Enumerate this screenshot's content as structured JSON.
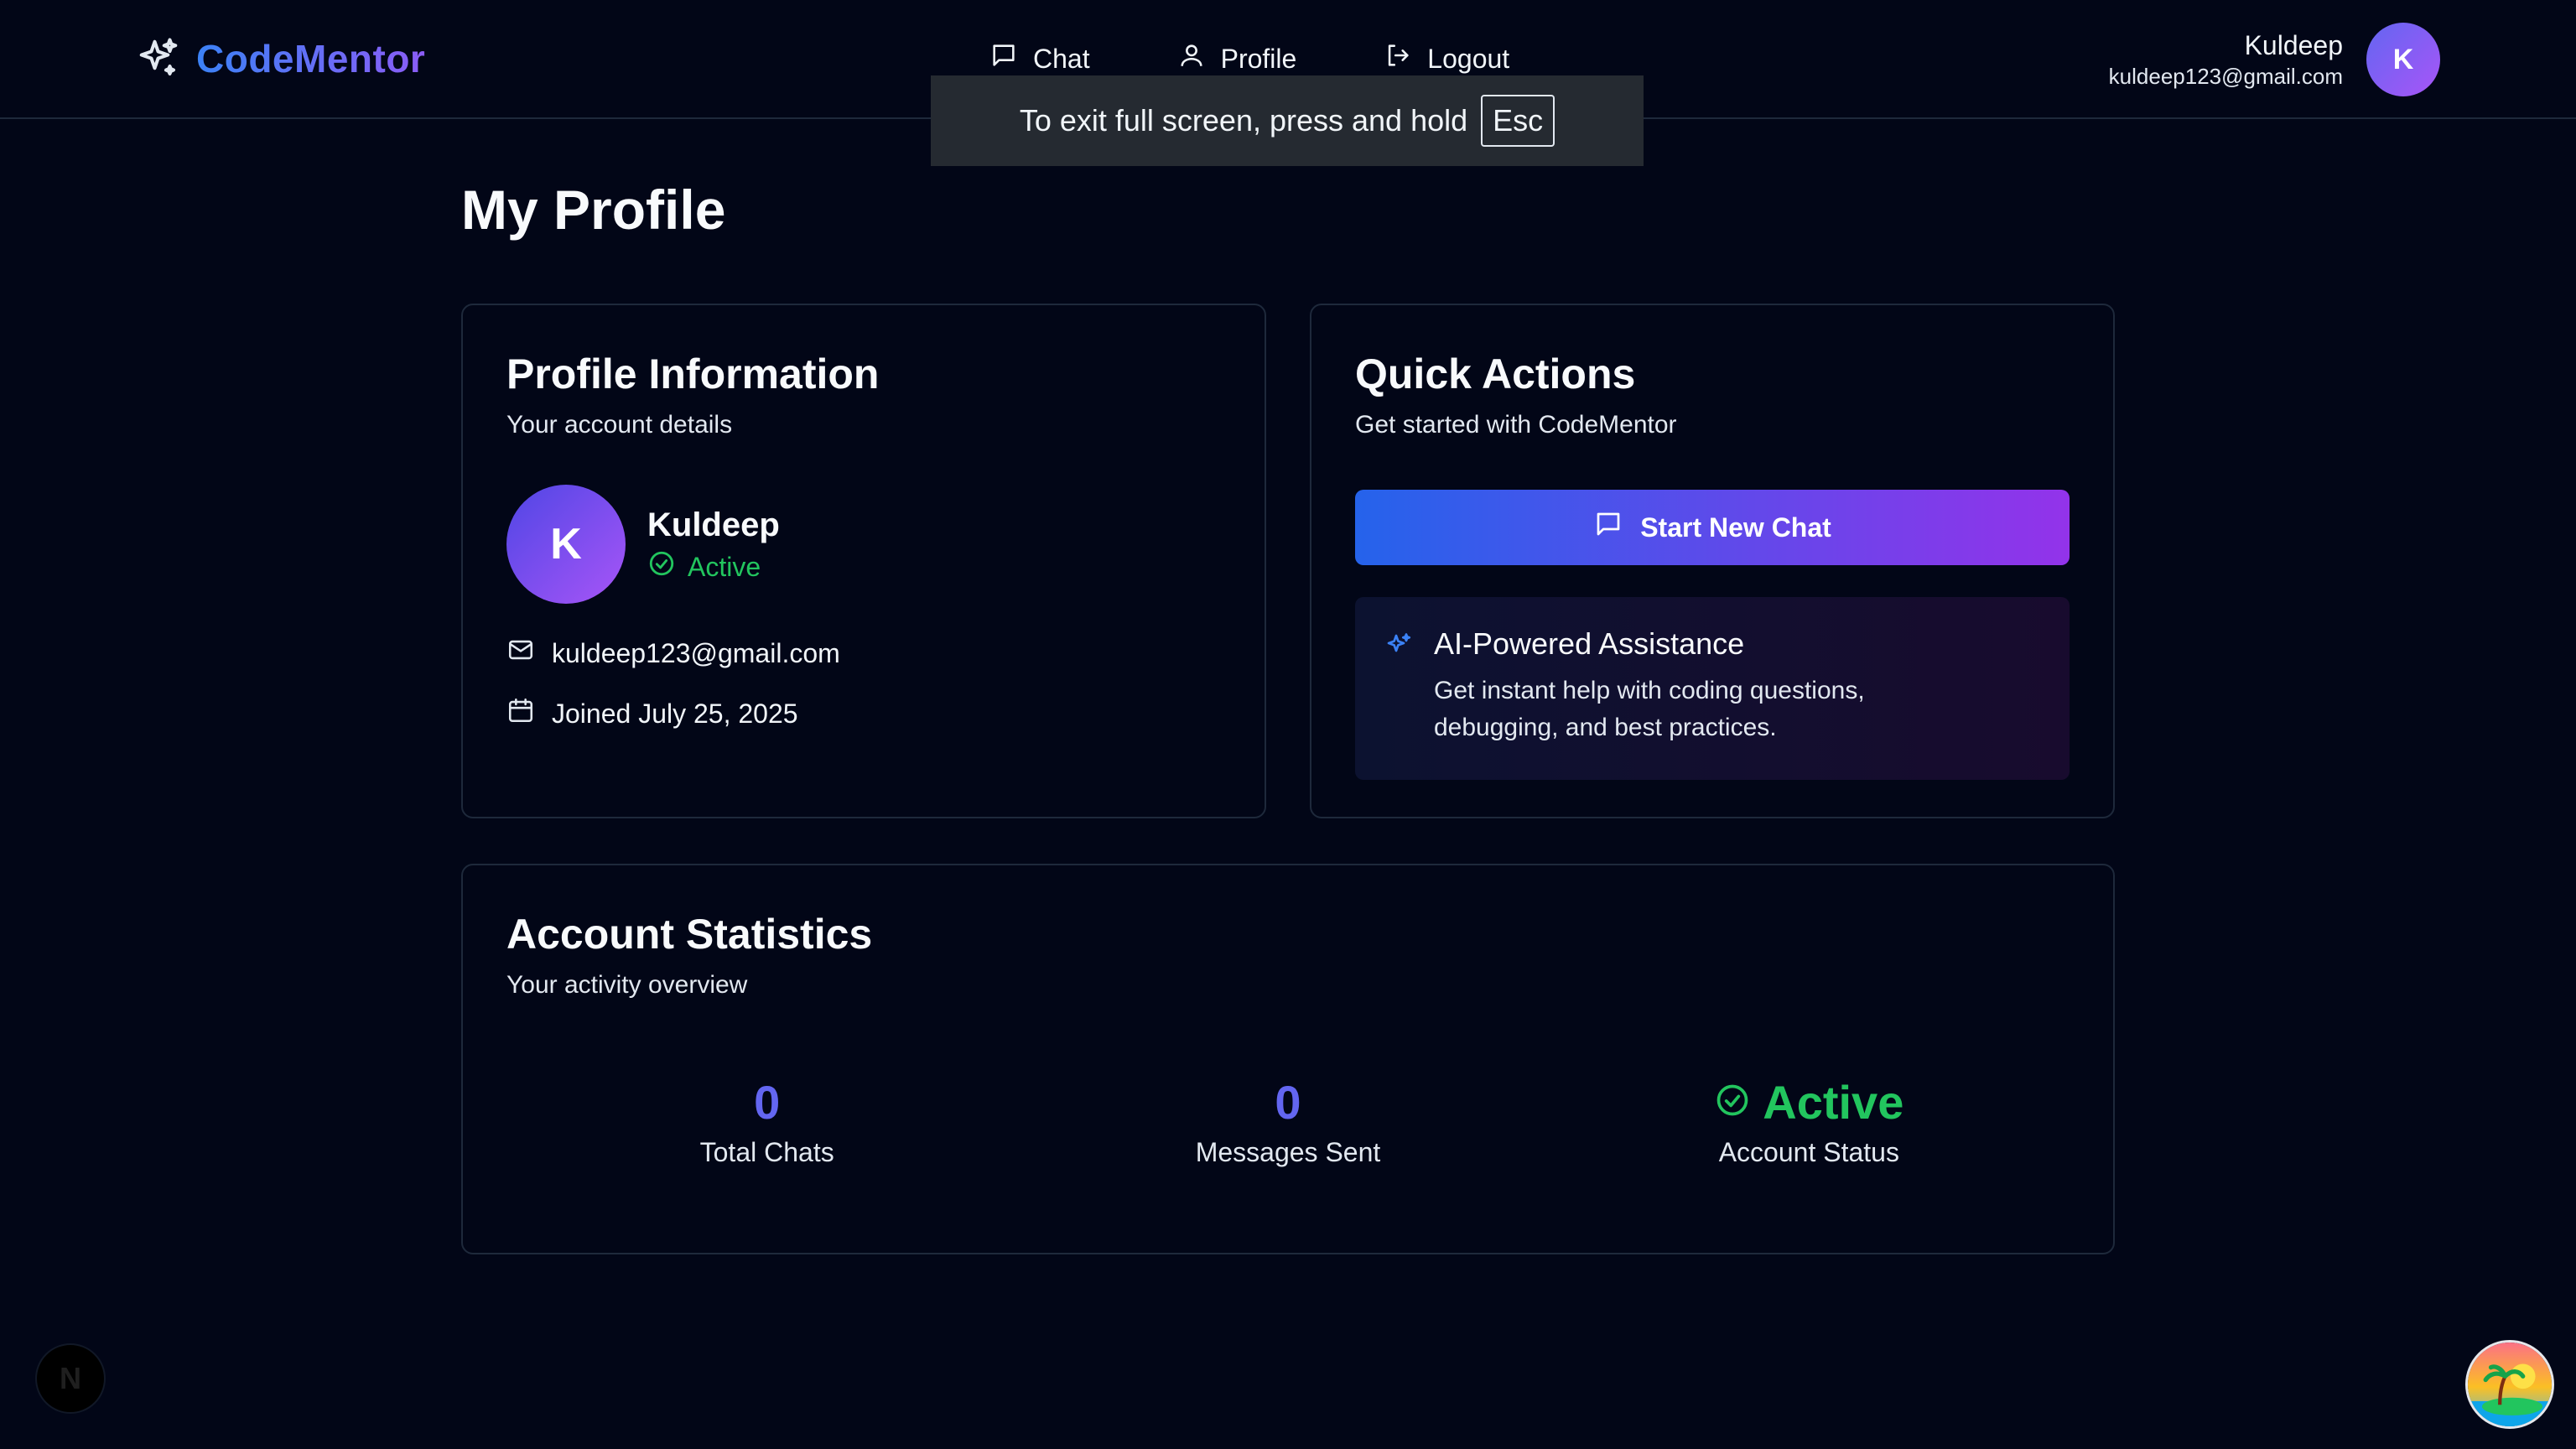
{
  "brand": {
    "name": "CodeMentor",
    "icon": "sparkles-icon",
    "gradient": [
      "#3b82f6",
      "#8b5cf6"
    ]
  },
  "nav": [
    {
      "label": "Chat",
      "icon": "message-square-icon"
    },
    {
      "label": "Profile",
      "icon": "user-icon"
    },
    {
      "label": "Logout",
      "icon": "logout-icon"
    }
  ],
  "user": {
    "name": "Kuldeep",
    "email": "kuldeep123@gmail.com",
    "initial": "K"
  },
  "toast": {
    "text": "To exit full screen, press and hold",
    "key": "Esc"
  },
  "page": {
    "title": "My Profile"
  },
  "profile_card": {
    "title": "Profile Information",
    "subtitle": "Your account details",
    "name": "Kuldeep",
    "initial": "K",
    "status": "Active",
    "email": "kuldeep123@gmail.com",
    "joined": "Joined July 25, 2025"
  },
  "actions_card": {
    "title": "Quick Actions",
    "subtitle": "Get started with CodeMentor",
    "start_chat_label": "Start New Chat",
    "ai_title": "AI-Powered Assistance",
    "ai_desc": "Get instant help with coding questions, debugging, and best practices."
  },
  "stats_card": {
    "title": "Account Statistics",
    "subtitle": "Your activity overview",
    "stats": [
      {
        "value": "0",
        "label": "Total Chats"
      },
      {
        "value": "0",
        "label": "Messages Sent"
      },
      {
        "value": "Active",
        "label": "Account Status"
      }
    ]
  },
  "colors": {
    "background": "#020617",
    "accent": "#6366f1",
    "success": "#22c55e",
    "border": "#1e293b"
  },
  "widgets": {
    "next_badge": "N"
  }
}
